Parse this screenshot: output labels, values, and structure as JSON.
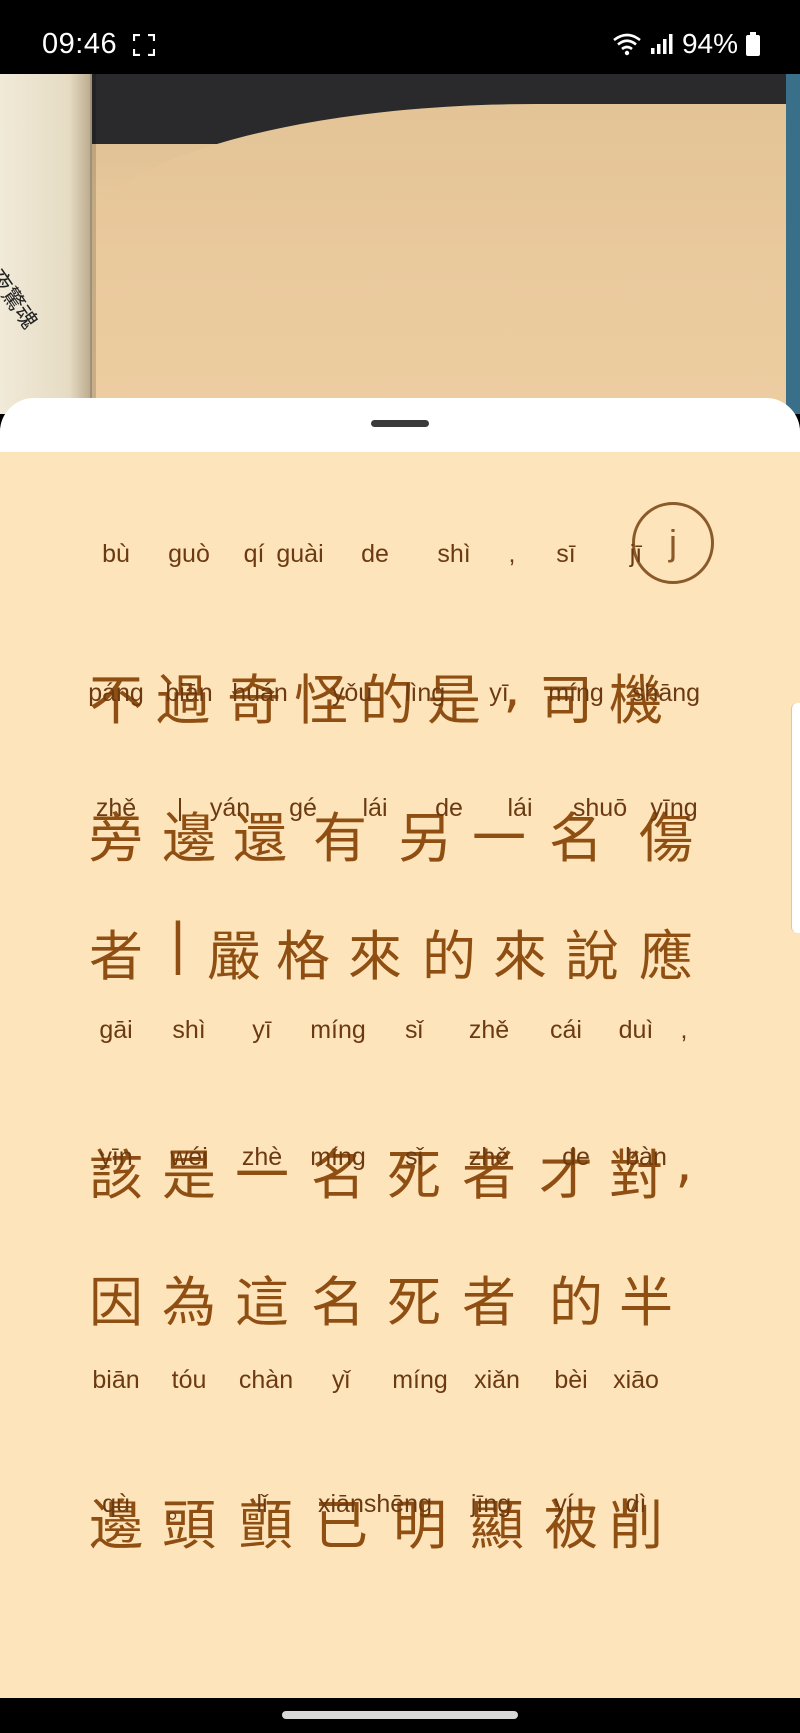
{
  "status_bar": {
    "time": "09:46",
    "battery": "94%",
    "icons": [
      "screenshot-icon",
      "wifi-icon",
      "signal-icon",
      "battery-icon"
    ]
  },
  "photo": {
    "book_title_fragment": "午夜驚魂"
  },
  "sheet": {
    "j_button_label": "j",
    "lines": [
      {
        "pinyin": [
          "bù",
          "guò",
          "qí",
          "guài",
          "de",
          "shì",
          ",",
          "sī",
          "jī"
        ],
        "hanzi": [
          "不",
          "過",
          "奇",
          "怪",
          "的",
          "是",
          ",",
          "司",
          "機"
        ]
      },
      {
        "pinyin": [
          "páng",
          "biān",
          "huán",
          "yǒu",
          "lìng",
          "yī",
          "míng",
          "shāng"
        ],
        "hanzi": [
          "旁",
          "邊",
          "還",
          "有",
          "另",
          "一",
          "名",
          "傷"
        ]
      },
      {
        "pinyin": [
          "zhě",
          "|",
          "yán",
          "gé",
          "lái",
          "de",
          "lái",
          "shuō",
          "yīng"
        ],
        "hanzi": [
          "者",
          "|",
          "嚴",
          "格",
          "來",
          "的",
          "來",
          "說",
          "應"
        ]
      },
      {
        "pinyin": [
          "gāi",
          "shì",
          "yī",
          "míng",
          "sǐ",
          "zhě",
          "cái",
          "duì",
          ","
        ],
        "hanzi": [
          "該",
          "是",
          "一",
          "名",
          "死",
          "者",
          "才",
          "對",
          ","
        ]
      },
      {
        "pinyin": [
          "yīn",
          "wéi",
          "zhè",
          "míng",
          "sǐ",
          "zhě",
          "de",
          "bàn"
        ],
        "hanzi": [
          "因",
          "為",
          "這",
          "名",
          "死",
          "者",
          "的",
          "半"
        ]
      },
      {
        "pinyin": [
          "biān",
          "tóu",
          "chàn",
          "yǐ",
          "míng",
          "xiǎn",
          "bèi",
          "xiāo"
        ],
        "hanzi": [
          "邊",
          "頭",
          "顫",
          "已",
          "明",
          "顯",
          "被",
          "削"
        ]
      },
      {
        "pinyin": [
          "qù",
          "。",
          "lǐ",
          "xiānshēng",
          "jīng",
          "yí",
          "dì"
        ],
        "hanzi": []
      }
    ]
  },
  "colors": {
    "sheet_background": "#fee4bb",
    "text_brown": "#8f4f12",
    "pinyin_brown": "#6b3a12"
  }
}
